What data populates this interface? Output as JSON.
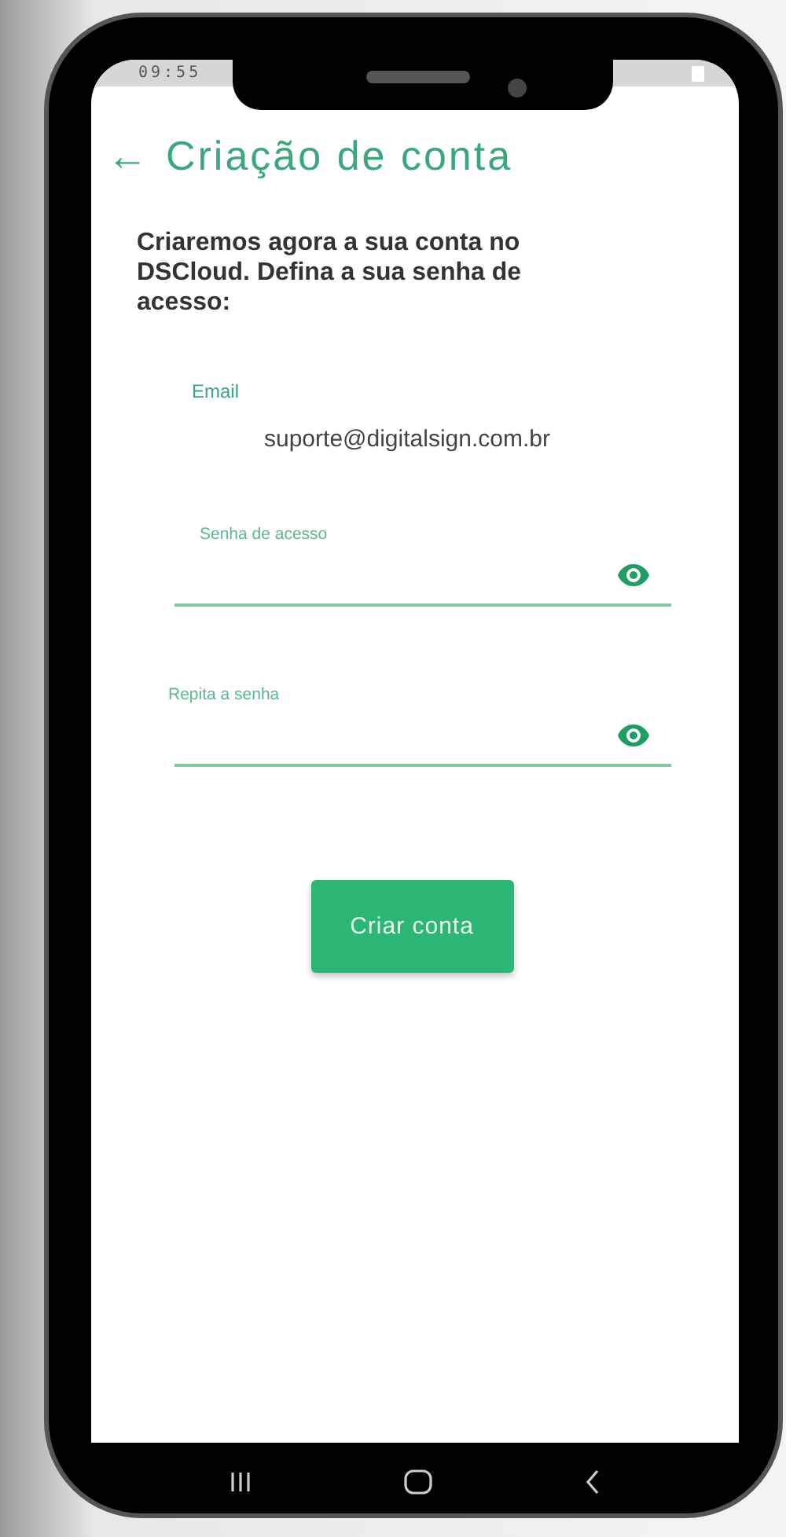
{
  "status_bar": {
    "time": "09:55"
  },
  "header": {
    "back": "←",
    "title": "Criação de conta"
  },
  "intro": "Criaremos agora a sua conta no DSCloud. Defina a sua senha de acesso:",
  "fields": [
    {
      "kind": "text",
      "label": "Email",
      "value": "suporte@digitalsign.com.br"
    },
    {
      "kind": "password",
      "label": "Senha de acesso"
    },
    {
      "kind": "password",
      "label": "Repita a senha"
    }
  ],
  "button": {
    "label": "Criar conta"
  }
}
